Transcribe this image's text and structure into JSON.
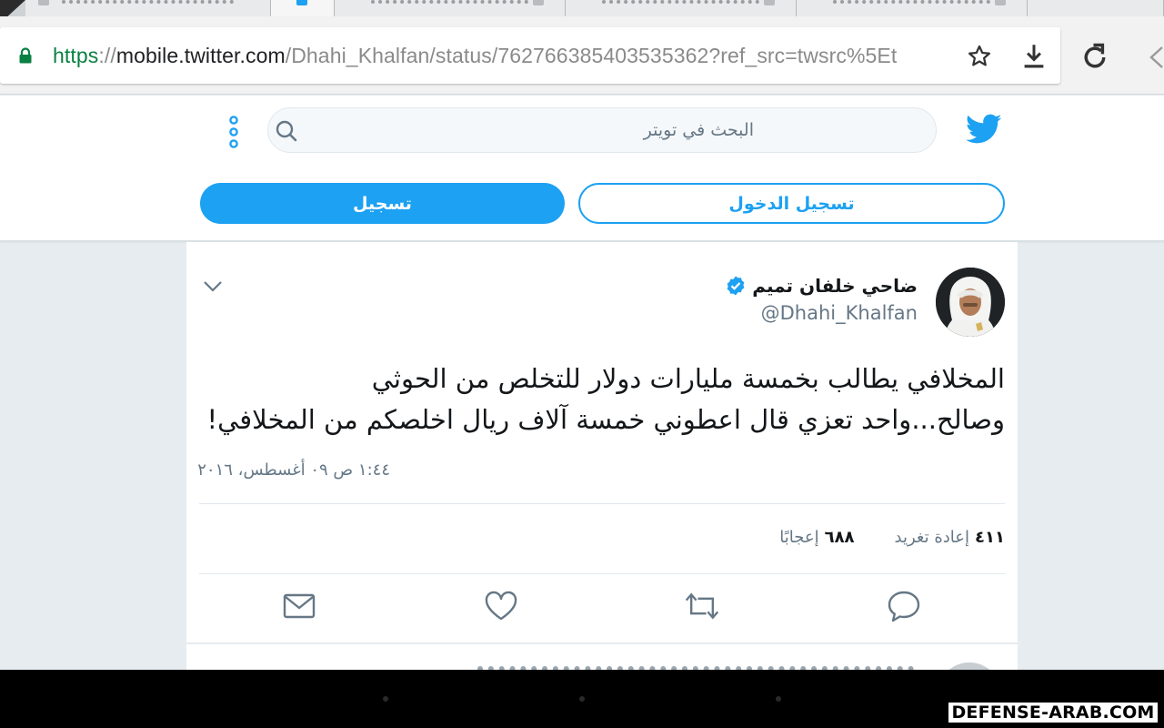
{
  "browser": {
    "url": {
      "scheme": "https",
      "separator": "://",
      "host": "mobile.twitter.com",
      "path": "/Dhahi_Khalfan/status/762766385403535362?ref_src=twsrc%5Et"
    }
  },
  "header": {
    "search_placeholder": "البحث في تويتر",
    "signup_label": "تسجيل",
    "login_label": "تسجيل الدخول"
  },
  "tweet": {
    "author_name": "ضاحي خلفان تميم",
    "author_handle": "@Dhahi_Khalfan",
    "verified": true,
    "text_line1": "المخلافي يطالب بخمسة مليارات دولار للتخلص من الحوثي",
    "text_line2": "وصالح...واحد تعزي قال اعطوني خمسة آلاف ريال اخلصكم من المخلافي!",
    "timestamp": "١:٤٤ ص ٠٩ أغسطس، ٢٠١٦",
    "retweets_count": "٤١١",
    "retweets_label": "إعادة تغريد",
    "likes_count": "٦٨٨",
    "likes_label": "إعجابًا"
  },
  "watermark": "DEFENSE-ARAB.COM",
  "colors": {
    "twitter_blue": "#1da1f2",
    "secure_green": "#0b8043",
    "muted_text": "#657786",
    "page_background": "#e6ecf0"
  },
  "icons": [
    "lock-icon",
    "star-icon",
    "download-icon",
    "reload-icon",
    "twitter-bird-icon",
    "search-icon",
    "more-vertical-icon",
    "chevron-down-icon",
    "verified-badge-icon",
    "mail-icon",
    "heart-icon",
    "retweet-icon",
    "reply-icon"
  ]
}
